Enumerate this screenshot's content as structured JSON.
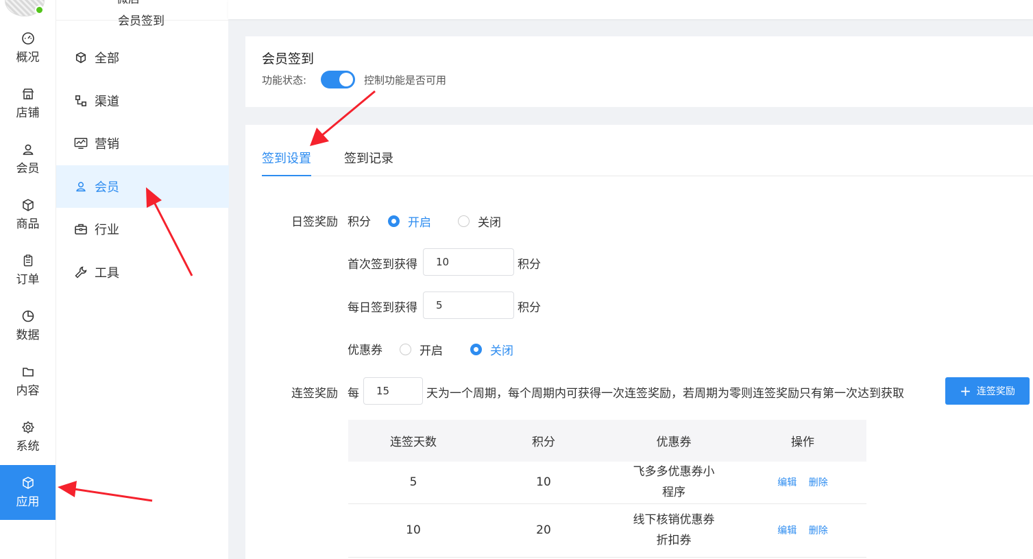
{
  "rail": {
    "items": [
      {
        "label": "概况",
        "icon": "dashboard-icon"
      },
      {
        "label": "店铺",
        "icon": "store-icon"
      },
      {
        "label": "会员",
        "icon": "user-icon"
      },
      {
        "label": "商品",
        "icon": "box-icon"
      },
      {
        "label": "订单",
        "icon": "clipboard-icon"
      },
      {
        "label": "数据",
        "icon": "pie-chart-icon"
      },
      {
        "label": "内容",
        "icon": "folder-icon"
      },
      {
        "label": "系统",
        "icon": "gear-icon"
      },
      {
        "label": "应用",
        "icon": "box-icon"
      }
    ],
    "active_index": 8,
    "active_color": "#2d8cf0"
  },
  "menu": {
    "header_name": "微店",
    "header_sub": "会员签到",
    "items": [
      {
        "label": "全部",
        "icon": "cube-icon"
      },
      {
        "label": "渠道",
        "icon": "channel-icon"
      },
      {
        "label": "营销",
        "icon": "monitor-chart-icon"
      },
      {
        "label": "会员",
        "icon": "user-icon"
      },
      {
        "label": "行业",
        "icon": "briefcase-icon"
      },
      {
        "label": "工具",
        "icon": "wrench-icon"
      }
    ],
    "active_index": 3
  },
  "header": {
    "title": "会员签到",
    "status_label": "功能状态:",
    "status_on": true,
    "status_hint": "控制功能是否可用"
  },
  "tabs": [
    {
      "label": "签到设置",
      "active": true
    },
    {
      "label": "签到记录",
      "active": false
    }
  ],
  "daily": {
    "label": "日签奖励",
    "points_label": "积分",
    "open_label": "开启",
    "close_label": "关闭",
    "points_enabled": true,
    "first_label": "首次签到获得",
    "first_value": "10",
    "daily_label": "每日签到获得",
    "daily_value": "5",
    "unit": "积分",
    "coupon_label": "优惠券",
    "coupon_enabled": false
  },
  "streak": {
    "label": "连签奖励",
    "every": "每",
    "cycle_days": "15",
    "desc": "天为一个周期，每个周期内可获得一次连签奖励，若周期为零则连签奖励只有第一次达到获取",
    "add_button": "连签奖励"
  },
  "table": {
    "headers": [
      "连签天数",
      "积分",
      "优惠券",
      "操作"
    ],
    "rows": [
      {
        "days": "5",
        "points": "10",
        "coupon": "飞多多优惠券小程序"
      },
      {
        "days": "10",
        "points": "20",
        "coupon": "线下核销优惠券折扣券"
      }
    ],
    "edit_label": "编辑",
    "delete_label": "删除"
  },
  "colors": {
    "accent": "#2d8cf0",
    "arrow": "#f5222d"
  }
}
